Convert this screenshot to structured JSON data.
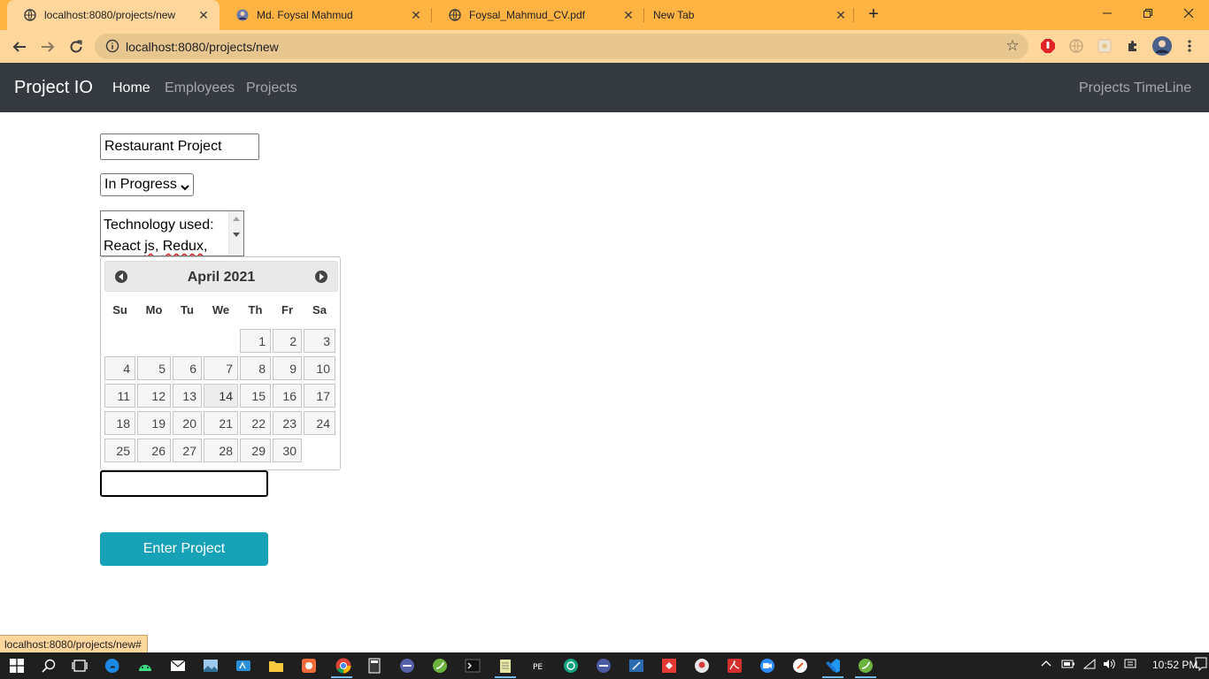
{
  "browser": {
    "tabs": [
      {
        "title": "localhost:8080/projects/new",
        "favicon": "globe-icon",
        "active": true
      },
      {
        "title": "Md. Foysal Mahmud",
        "favicon": "profile-icon",
        "active": false
      },
      {
        "title": "Foysal_Mahmud_CV.pdf",
        "favicon": "globe-icon",
        "active": false
      },
      {
        "title": "New Tab",
        "favicon": "",
        "active": false
      }
    ],
    "url": "localhost:8080/projects/new",
    "status_url": "localhost:8080/projects/new#",
    "colors": {
      "tabstrip": "#ffb343",
      "toolbar": "#ffd79c"
    }
  },
  "navbar": {
    "brand": "Project IO",
    "links": [
      "Home",
      "Employees",
      "Projects"
    ],
    "active_link": "Home",
    "right_link": "Projects TimeLine"
  },
  "form": {
    "project_name": "Restaurant Project",
    "status": "In Progress",
    "description": {
      "line1": "Technology used:",
      "line2_a": "React ",
      "line2_b": "js",
      "line2_c": ", ",
      "line2_d": "Redux",
      "line2_e": ","
    },
    "date_value": "",
    "submit_label": "Enter Project"
  },
  "datepicker": {
    "month_year": "April 2021",
    "weekdays": [
      "Su",
      "Mo",
      "Tu",
      "We",
      "Th",
      "Fr",
      "Sa"
    ],
    "first_weekday_index": 4,
    "days_in_month": 30,
    "hover_day": 14
  },
  "taskbar": {
    "clock": "10:52 PM",
    "accent": "#76b9ed"
  }
}
